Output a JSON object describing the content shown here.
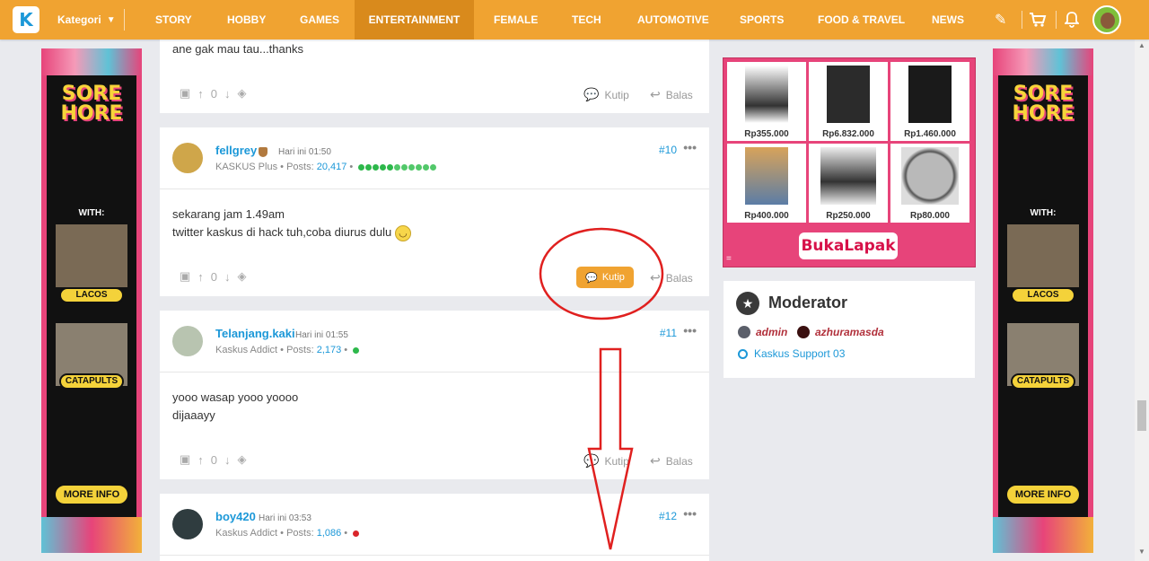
{
  "nav": {
    "logo": "K",
    "kategori": "Kategori",
    "items": [
      "STORY",
      "HOBBY",
      "GAMES",
      "ENTERTAINMENT",
      "FEMALE",
      "TECH",
      "AUTOMOTIVE",
      "SPORTS",
      "FOOD & TRAVEL",
      "NEWS"
    ],
    "active": "ENTERTAINMENT"
  },
  "side_banner": {
    "title_line1": "SORE",
    "title_line2": "HORE",
    "with_label": "WITH:",
    "guest1": "LACOS",
    "guest2": "CATAPULTS",
    "more_info": "MORE INFO"
  },
  "posts": [
    {
      "content_lines": [
        "ane gak mau tau...thanks"
      ],
      "vote_count": "0",
      "quote_label": "Kutip",
      "reply_label": "Balas"
    },
    {
      "username": "fellgrey",
      "time": "Hari ini 01:50",
      "rank": "KASKUS Plus",
      "posts_label": "Posts:",
      "posts_count": "20,417",
      "post_number": "#10",
      "content_lines": [
        "sekarang jam 1.49am",
        "twitter kaskus di hack tuh,coba diurus dulu"
      ],
      "vote_count": "0",
      "quote_label": "Kutip",
      "reply_label": "Balas"
    },
    {
      "username": "Telanjang.kaki",
      "time": "Hari ini 01:55",
      "rank": "Kaskus Addict",
      "posts_label": "Posts:",
      "posts_count": "2,173",
      "post_number": "#11",
      "content_lines": [
        "yooo wasap yooo yoooo",
        "dijaaayy"
      ],
      "vote_count": "0",
      "quote_label": "Kutip",
      "reply_label": "Balas"
    },
    {
      "username": "boy420",
      "time": "Hari ini 03:53",
      "rank": "Kaskus Addict",
      "posts_label": "Posts:",
      "posts_count": "1,086",
      "post_number": "#12"
    }
  ],
  "ad": {
    "prices": [
      "Rp355.000",
      "Rp6.832.000",
      "Rp1.460.000",
      "Rp400.000",
      "Rp250.000",
      "Rp80.000"
    ],
    "brand": "BukaLapak",
    "footer_mark": "="
  },
  "moderator": {
    "title": "Moderator",
    "mods": [
      "admin",
      "azhuramasda"
    ],
    "support": "Kaskus Support 03"
  },
  "colors": {
    "brand_orange": "#f0a331",
    "kaskus_blue": "#1c98d8",
    "annotation_red": "#e0201f",
    "bukalapak_pink": "#e7447a"
  }
}
